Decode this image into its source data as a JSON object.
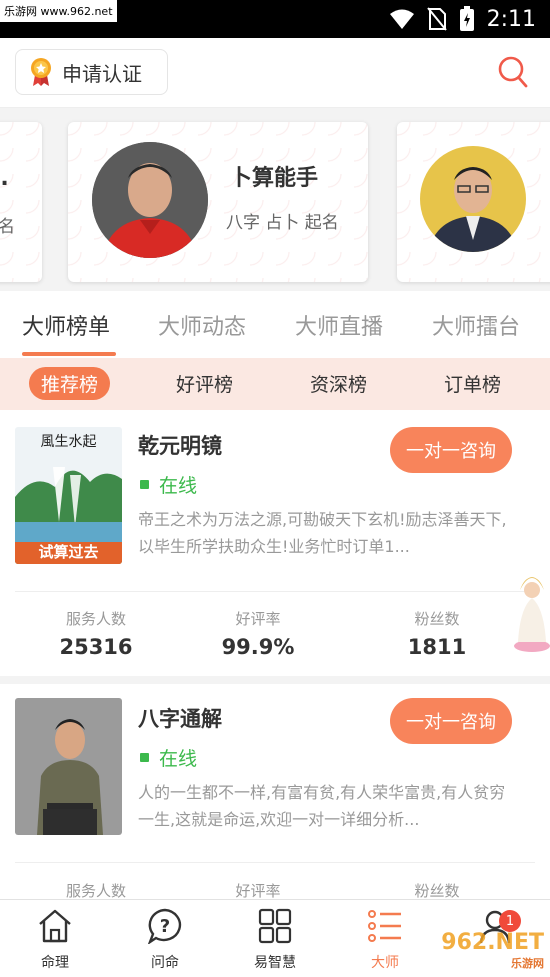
{
  "status_bar": {
    "watermark": "乐游网 www.962.net",
    "time": "2:11"
  },
  "header": {
    "cert_label": "申请认证"
  },
  "carousel": {
    "left_partial": {
      "name": "..",
      "tags": "名"
    },
    "center": {
      "name": "卜算能手",
      "tags": "八字 占卜 起名"
    },
    "right_partial": {
      "name": "",
      "tags": ""
    }
  },
  "tabs": [
    "大师榜单",
    "大师动态",
    "大师直播",
    "大师擂台"
  ],
  "subtabs": [
    "推荐榜",
    "好评榜",
    "资深榜",
    "订单榜"
  ],
  "masters": [
    {
      "name": "乾元明镜",
      "status": "在线",
      "desc": "帝王之术为万法之源,可勘破天下玄机!励志泽善天下,以毕生所学扶助众生!业务忙时订单1...",
      "consult": "一对一咨询",
      "thumb_caption": "试算过去",
      "thumb_title": "風生水起",
      "stats": [
        {
          "label": "服务人数",
          "value": "25316"
        },
        {
          "label": "好评率",
          "value": "99.9%"
        },
        {
          "label": "粉丝数",
          "value": "1811"
        }
      ]
    },
    {
      "name": "八字通解",
      "status": "在线",
      "desc": "人的一生都不一样,有富有贫,有人荣华富贵,有人贫穷一生,这就是命运,欢迎一对一详细分析...",
      "consult": "一对一咨询",
      "stats": [
        {
          "label": "服务人数",
          "value": ""
        },
        {
          "label": "好评率",
          "value": ""
        },
        {
          "label": "粉丝数",
          "value": ""
        }
      ]
    }
  ],
  "bottom_nav": [
    {
      "label": "命理",
      "icon": "house-icon"
    },
    {
      "label": "问命",
      "icon": "question-bubble-icon"
    },
    {
      "label": "易智慧",
      "icon": "grid-icon"
    },
    {
      "label": "大师",
      "icon": "list-icon",
      "active": true
    },
    {
      "label": "",
      "icon": "user-icon",
      "badge": "1"
    }
  ],
  "site_watermark": {
    "big": "962.NET",
    "small": "乐游网"
  },
  "colors": {
    "accent": "#f47b4f",
    "online": "#3cb94c",
    "badge": "#f04a3a"
  }
}
